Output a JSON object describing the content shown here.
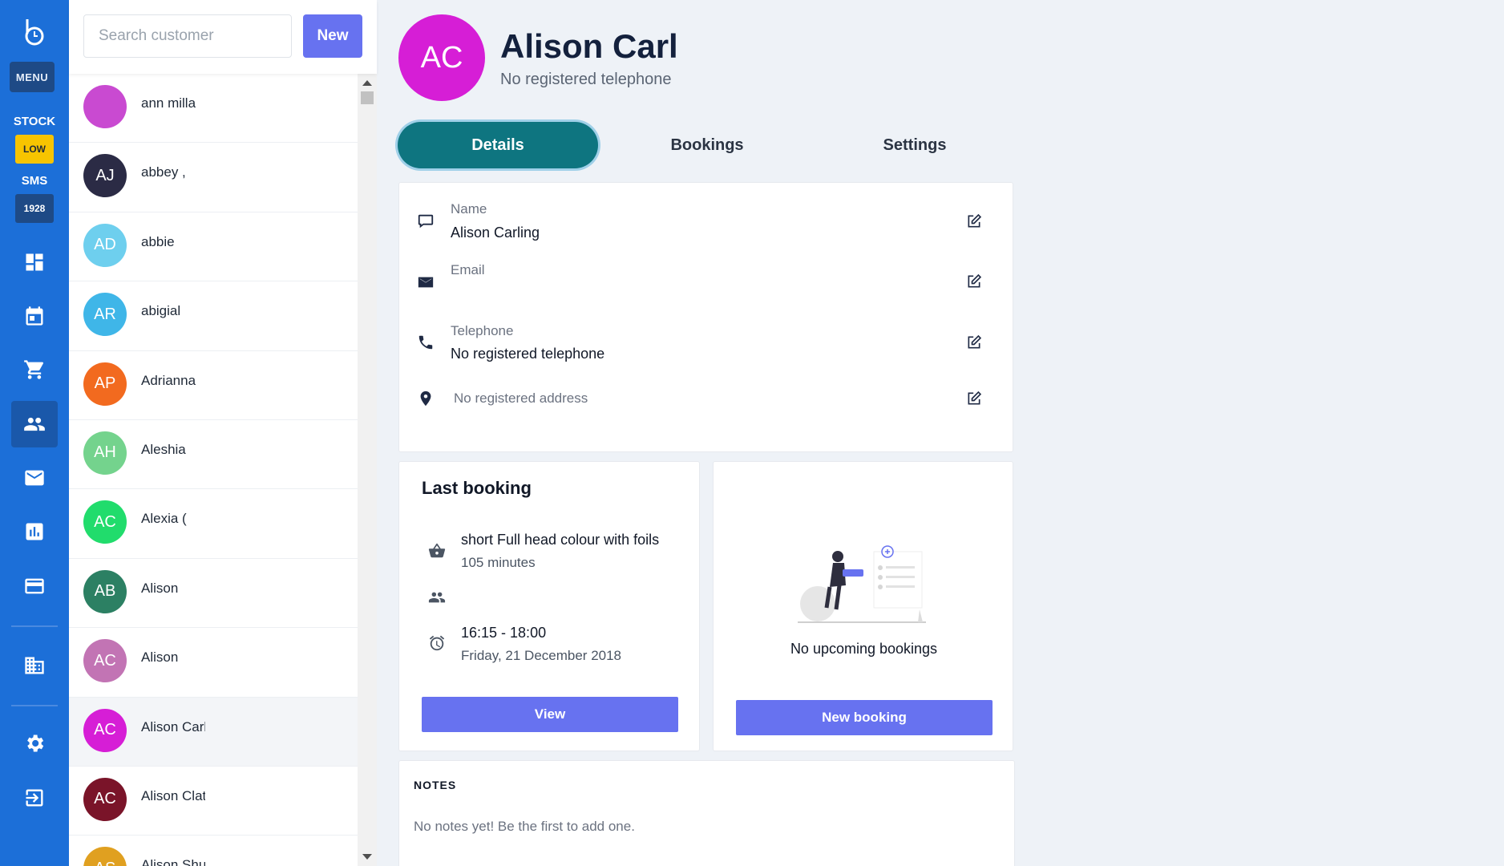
{
  "rail": {
    "menu_label": "MENU",
    "stock_label": "STOCK",
    "stock_badge": "LOW",
    "sms_label": "SMS",
    "sms_badge": "1928",
    "nav_icons": [
      "dashboard-icon",
      "calendar-icon",
      "cart-icon",
      "customers-icon",
      "mail-icon",
      "reports-icon",
      "payments-icon",
      "business-icon",
      "settings-icon",
      "logout-icon"
    ]
  },
  "search": {
    "placeholder": "Search customer",
    "new_label": "New"
  },
  "customers": [
    {
      "initials": "",
      "name": "ann milla",
      "color": "#c94ad1"
    },
    {
      "initials": "AJ",
      "name": "abbey ,",
      "color": "#2b2b45"
    },
    {
      "initials": "AD",
      "name": "abbie",
      "color": "#6ecfee"
    },
    {
      "initials": "AR",
      "name": "abigial",
      "color": "#3fb6e8"
    },
    {
      "initials": "AP",
      "name": "Adrianna",
      "color": "#f26a1f"
    },
    {
      "initials": "AH",
      "name": "Aleshia",
      "color": "#74d38d"
    },
    {
      "initials": "AC",
      "name": "Alexia (",
      "color": "#21dc6c"
    },
    {
      "initials": "AB",
      "name": "Alison",
      "color": "#2c8063"
    },
    {
      "initials": "AC",
      "name": "Alison",
      "color": "#c274b4"
    },
    {
      "initials": "AC",
      "name": "Alison Carl",
      "color": "#d61ed6"
    },
    {
      "initials": "AC",
      "name": "Alison Clat",
      "color": "#7a1429"
    },
    {
      "initials": "AS",
      "name": "Alison Shuttleworth",
      "color": "#e0a020"
    }
  ],
  "header": {
    "initials": "AC",
    "name": "Alison Carl",
    "subtitle": "No registered telephone"
  },
  "tabs": [
    {
      "label": "Details",
      "active": true
    },
    {
      "label": "Bookings",
      "active": false
    },
    {
      "label": "Settings",
      "active": false
    }
  ],
  "details": {
    "name_label": "Name",
    "name_value": "Alison Carling",
    "email_label": "Email",
    "email_value": "",
    "phone_label": "Telephone",
    "phone_value": "No registered telephone",
    "address_value": "No registered address"
  },
  "last_booking": {
    "title": "Last booking",
    "service": "short Full head colour with foils",
    "duration": "105 minutes",
    "time": "16:15 - 18:00",
    "date": "Friday, 21 December 2018",
    "view_label": "View"
  },
  "upcoming": {
    "empty_text": "No upcoming bookings",
    "button_label": "New booking"
  },
  "notes": {
    "title": "NOTES",
    "empty_text": "No notes yet! Be the first to add one."
  },
  "colors": {
    "rail": "#1c6fd8",
    "accent": "#6772f0",
    "tab_active": "#0e7580",
    "header_avatar": "#d61ed6"
  }
}
